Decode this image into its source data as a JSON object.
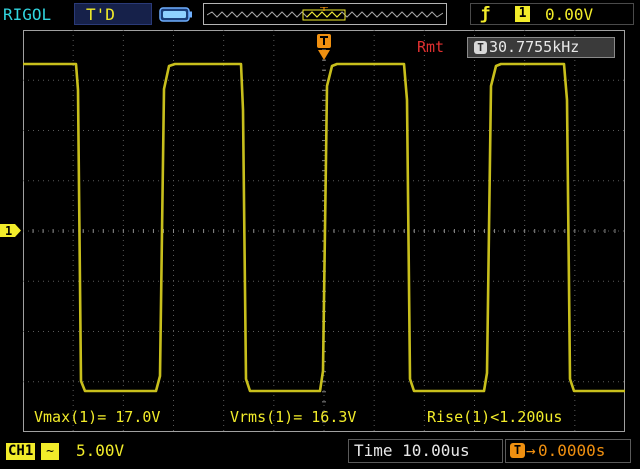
{
  "header": {
    "brand": "RIGOL",
    "trigger_status": "T'D",
    "trigger_edge_icon": "rising-edge-icon",
    "trigger_channel": "1",
    "trigger_level": "0.00V"
  },
  "readouts": {
    "rmt": "Rmt",
    "freq_badge": "T",
    "frequency": "30.7755kHz"
  },
  "measurements": {
    "vmax": "Vmax(1)= 17.0V",
    "vrms": "Vrms(1)= 16.3V",
    "rise": "Rise(1)<1.200us"
  },
  "channel": {
    "marker": "1",
    "tag": "CH1",
    "coupling_symbol": "~",
    "scale": "5.00V"
  },
  "timebase": {
    "label": "Time 10.00us",
    "pos_badge": "T",
    "pos_arrow": "→",
    "pos_value": "0.0000s"
  },
  "colors": {
    "ch1": "#f2ec2a",
    "brand": "#31d6e0",
    "rmt": "#e03030",
    "hpos": "#f09010"
  }
}
